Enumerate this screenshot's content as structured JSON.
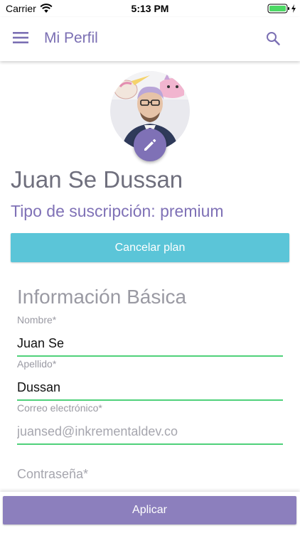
{
  "status_bar": {
    "carrier": "Carrier",
    "time": "5:13 PM",
    "icons": [
      "wifi-icon",
      "battery-icon",
      "charging-bolt-icon"
    ]
  },
  "app_bar": {
    "title": "Mi Perfil",
    "icons": [
      "menu-icon",
      "search-icon"
    ]
  },
  "profile": {
    "avatar_icon": "profile-photo",
    "edit_icon": "pencil-icon",
    "name": "Juan Se Dussan",
    "subscription": "Tipo de suscripción: premium",
    "cancel_label": "Cancelar plan"
  },
  "form": {
    "section_title": "Información Básica",
    "first_name": {
      "label": "Nombre*",
      "value": "Juan Se"
    },
    "last_name": {
      "label": "Apellido*",
      "value": "Dussan"
    },
    "email": {
      "label": "Correo electrónico*",
      "placeholder": "juansed@inkrementaldev.co"
    },
    "password": {
      "placeholder": "Contraseña*"
    }
  },
  "footer": {
    "apply_label": "Aplicar"
  },
  "colors": {
    "primary": "#7f71b6",
    "cancel_button": "#5bc5d8",
    "apply_button": "#8c7fbd",
    "field_underline": "#4fd17a",
    "name_text": "#6f6f7d"
  }
}
